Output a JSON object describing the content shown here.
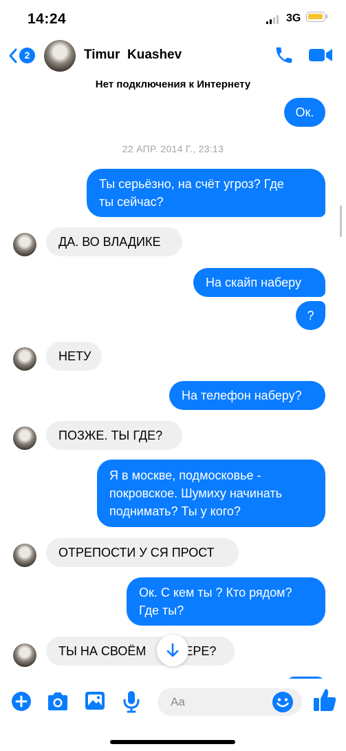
{
  "status_bar": {
    "time": "14:24",
    "network": "3G"
  },
  "header": {
    "back_badge": "2",
    "contact_name": "Timur  Kuashev"
  },
  "notice": "Нет подключения к Интернету",
  "timestamp": "22 АПР. 2014 Г., 23:13",
  "messages": [
    {
      "text": "Ок.",
      "direction": "outgoing"
    },
    {
      "line1": "Ты серьёзно, на счёт угроз? Где",
      "line2": "ты сейчас?",
      "direction": "outgoing"
    },
    {
      "text": "ДА. ВО ВЛАДИКЕ",
      "direction": "incoming"
    },
    {
      "text": "На скайп наберу",
      "direction": "outgoing"
    },
    {
      "text": "?",
      "direction": "outgoing"
    },
    {
      "text": "НЕТУ",
      "direction": "incoming"
    },
    {
      "text": "На телефон наберу?",
      "direction": "outgoing"
    },
    {
      "text": "ПОЗЖЕ. ТЫ ГДЕ?",
      "direction": "incoming"
    },
    {
      "line1": "Я в москве, подмосковье -",
      "line2": "покровское. Шумиху начинать",
      "line3": "поднимать? Ты у кого?",
      "direction": "outgoing"
    },
    {
      "text": "ОТРЕПОСТИ У СЯ ПРОСТ",
      "direction": "incoming"
    },
    {
      "line1": "Ок. С кем ты ? Кто рядом?",
      "line2": "Где ты?",
      "direction": "outgoing"
    },
    {
      "text_left": "ТЫ НА СВОЁМ",
      "text_right": "ЕРЕ?",
      "direction": "incoming"
    }
  ],
  "composer": {
    "placeholder": "Aa"
  },
  "colors": {
    "accent": "#0a7cff",
    "incoming_bubble": "#efefef",
    "battery": "#f7c534"
  },
  "icons": [
    "back-chevron-icon",
    "phone-icon",
    "video-camera-icon",
    "plus-icon",
    "camera-icon",
    "image-icon",
    "microphone-icon",
    "emoji-icon",
    "thumbs-up-icon",
    "arrow-down-icon"
  ]
}
